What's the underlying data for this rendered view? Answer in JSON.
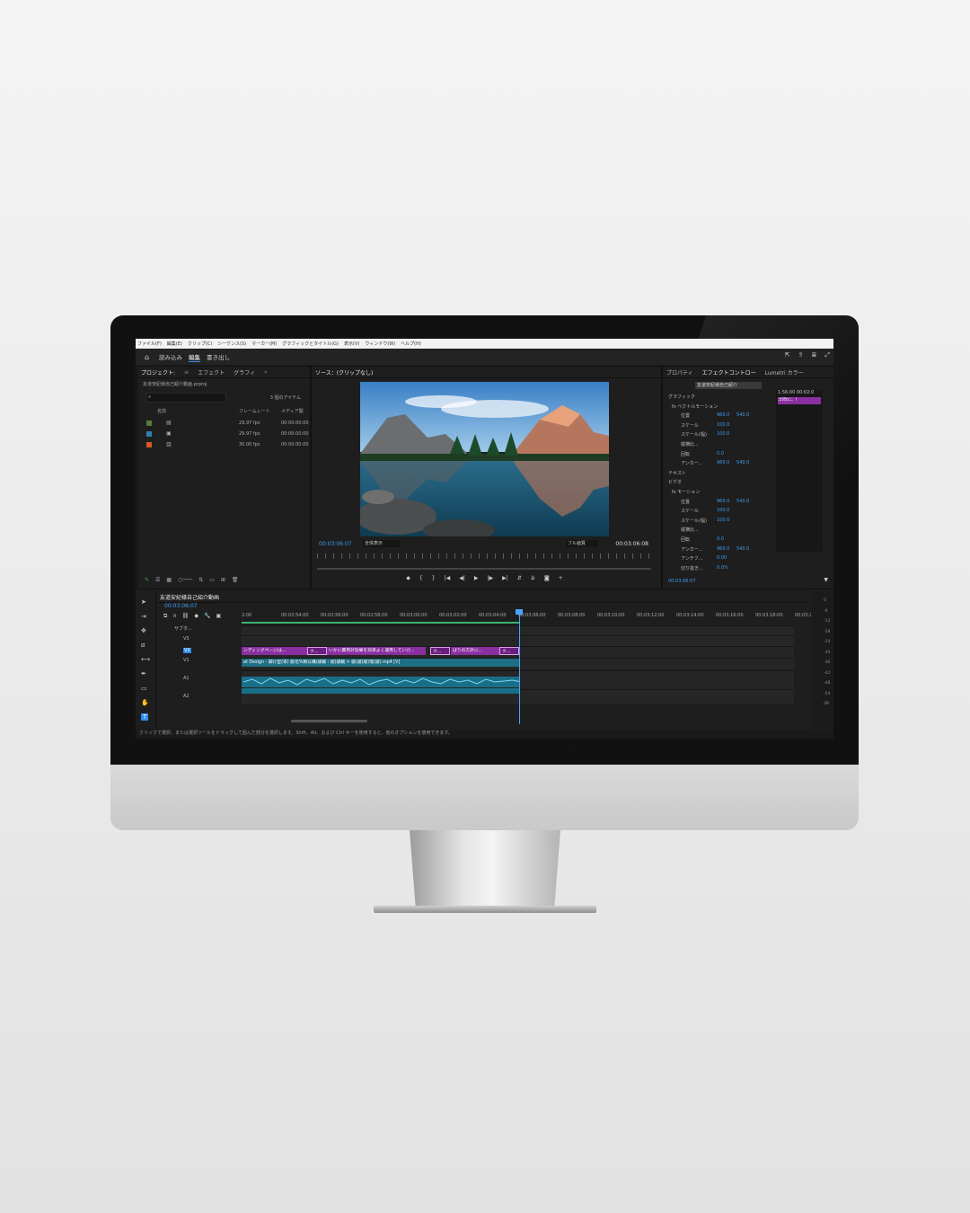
{
  "menu": [
    "ファイル(F)",
    "編集(E)",
    "クリップ(C)",
    "シーケンス(S)",
    "マーカー(M)",
    "グラフィックとタイトル(G)",
    "表示(V)",
    "ウィンドウ(W)",
    "ヘルプ(H)"
  ],
  "workspaces": {
    "import": "読み込み",
    "edit": "編集",
    "export": "書き出し"
  },
  "project_panel": {
    "tabs": [
      "プロジェクト:",
      "エフェクト",
      "グラフィ"
    ],
    "file": "友道安紀様自己紹介動画.prproj",
    "item_count": "3 個のアイテム",
    "col_name": "名前",
    "col_fps": "フレームレート",
    "col_media": "メディア開",
    "rows": [
      {
        "fps": "29.97 fps",
        "tc": "00:00:00:00",
        "color": "#4f7d3a"
      },
      {
        "fps": "29.97 fps",
        "tc": "00:00:00:00",
        "color": "#2f7fa8"
      },
      {
        "fps": "30.00 fps",
        "tc": "00:00:00:00",
        "color": "#d4591f"
      }
    ]
  },
  "source_panel": {
    "title": "ソース：(クリップなし)",
    "timecode_left": "00:03:06:07",
    "zoom": "全体表示",
    "quality": "フル画質",
    "timecode_right": "00:03:06:08"
  },
  "effect_panel": {
    "tabs": [
      "プロパティ",
      "エフェクトコントロー",
      "Lumetri カラー"
    ],
    "clip_button": "友道安紀様自己紹介",
    "mini_tc": "1:56:00  00:02:0",
    "mini_clip": "ゴ(吹に、！",
    "rows": [
      {
        "label": "グラフィック",
        "v1": "",
        "v2": ""
      },
      {
        "label": "fx  ベクトルモーション",
        "v1": "",
        "v2": ""
      },
      {
        "label": "位置",
        "v1": "960.0",
        "v2": "540.0"
      },
      {
        "label": "スケール",
        "v1": "100.0",
        "v2": ""
      },
      {
        "label": "スケール(幅)",
        "v1": "100.0",
        "v2": ""
      },
      {
        "label": "縦横比...",
        "v1": "",
        "v2": ""
      },
      {
        "label": "回転",
        "v1": "0.0",
        "v2": ""
      },
      {
        "label": "アンカー...",
        "v1": "960.0",
        "v2": "540.0"
      },
      {
        "label": "テキスト",
        "v1": "",
        "v2": ""
      },
      {
        "label": "ビデオ",
        "v1": "",
        "v2": ""
      },
      {
        "label": "fx  モーション",
        "v1": "",
        "v2": ""
      },
      {
        "label": "位置",
        "v1": "960.0",
        "v2": "540.0"
      },
      {
        "label": "スケール",
        "v1": "100.0",
        "v2": ""
      },
      {
        "label": "スケール(幅)",
        "v1": "100.0",
        "v2": ""
      },
      {
        "label": "縦横比...",
        "v1": "",
        "v2": ""
      },
      {
        "label": "回転",
        "v1": "0.0",
        "v2": ""
      },
      {
        "label": "アンカー...",
        "v1": "960.0",
        "v2": "540.0"
      },
      {
        "label": "アンチフ...",
        "v1": "0.00",
        "v2": ""
      },
      {
        "label": "切り抜き...",
        "v1": "0.0%",
        "v2": ""
      }
    ],
    "footer_tc": "00:03:06:07"
  },
  "timeline": {
    "sequence": "友道安紀様自己紹介動画",
    "timecode": "00:03:06:07",
    "ruler": [
      "2:00",
      "00:02:54:00",
      "00:02:56:00",
      "00:02:58:00",
      "00:03:00:00",
      "00:03:02:00",
      "00:03:04:00",
      "00:03:06:00",
      "00:03:08:00",
      "00:03:10:00",
      "00:03:12:00",
      "00:03:14:00",
      "00:03:16:00",
      "00:03:18:00",
      "00:03:2"
    ],
    "tracks": {
      "sub": "サブタ...",
      "v3": "V3",
      "v2": "V2",
      "v1": "V1",
      "a1": "A1",
      "a2": "A2"
    },
    "clips": {
      "v2_a": "ンディングページは...",
      "v2_b": "ク...",
      "v2_c": "いかに費用対効果を効率よく運用していけ...",
      "v2_d": "ク...",
      "v2_e": "ばりの方針に...",
      "v2_f": "ク...",
      "v1_main": "at Design - 脚け型(率) 脱毛%類以構(緩輔 : 総(緩輔 > 緩(緩(緩)瑠(緩).mp4 [V]",
      "fx": "fx"
    }
  },
  "meter_labels": [
    "0",
    "-6",
    "-12",
    "-18",
    "-24",
    "-30",
    "-36",
    "-42",
    "-48",
    "-54",
    "dB"
  ],
  "status": "クリックで選択、または選択ツールをドラッグして囲んだ部分を選択します。Shift、Alt、および Ctrl キーを使用すると、他のオプションを使用できます。",
  "colors": {
    "accent": "#2d8ceb",
    "clip_purple": "#8a2fa0",
    "clip_teal": "#1f7b8f",
    "audio": "#1a6f88"
  }
}
